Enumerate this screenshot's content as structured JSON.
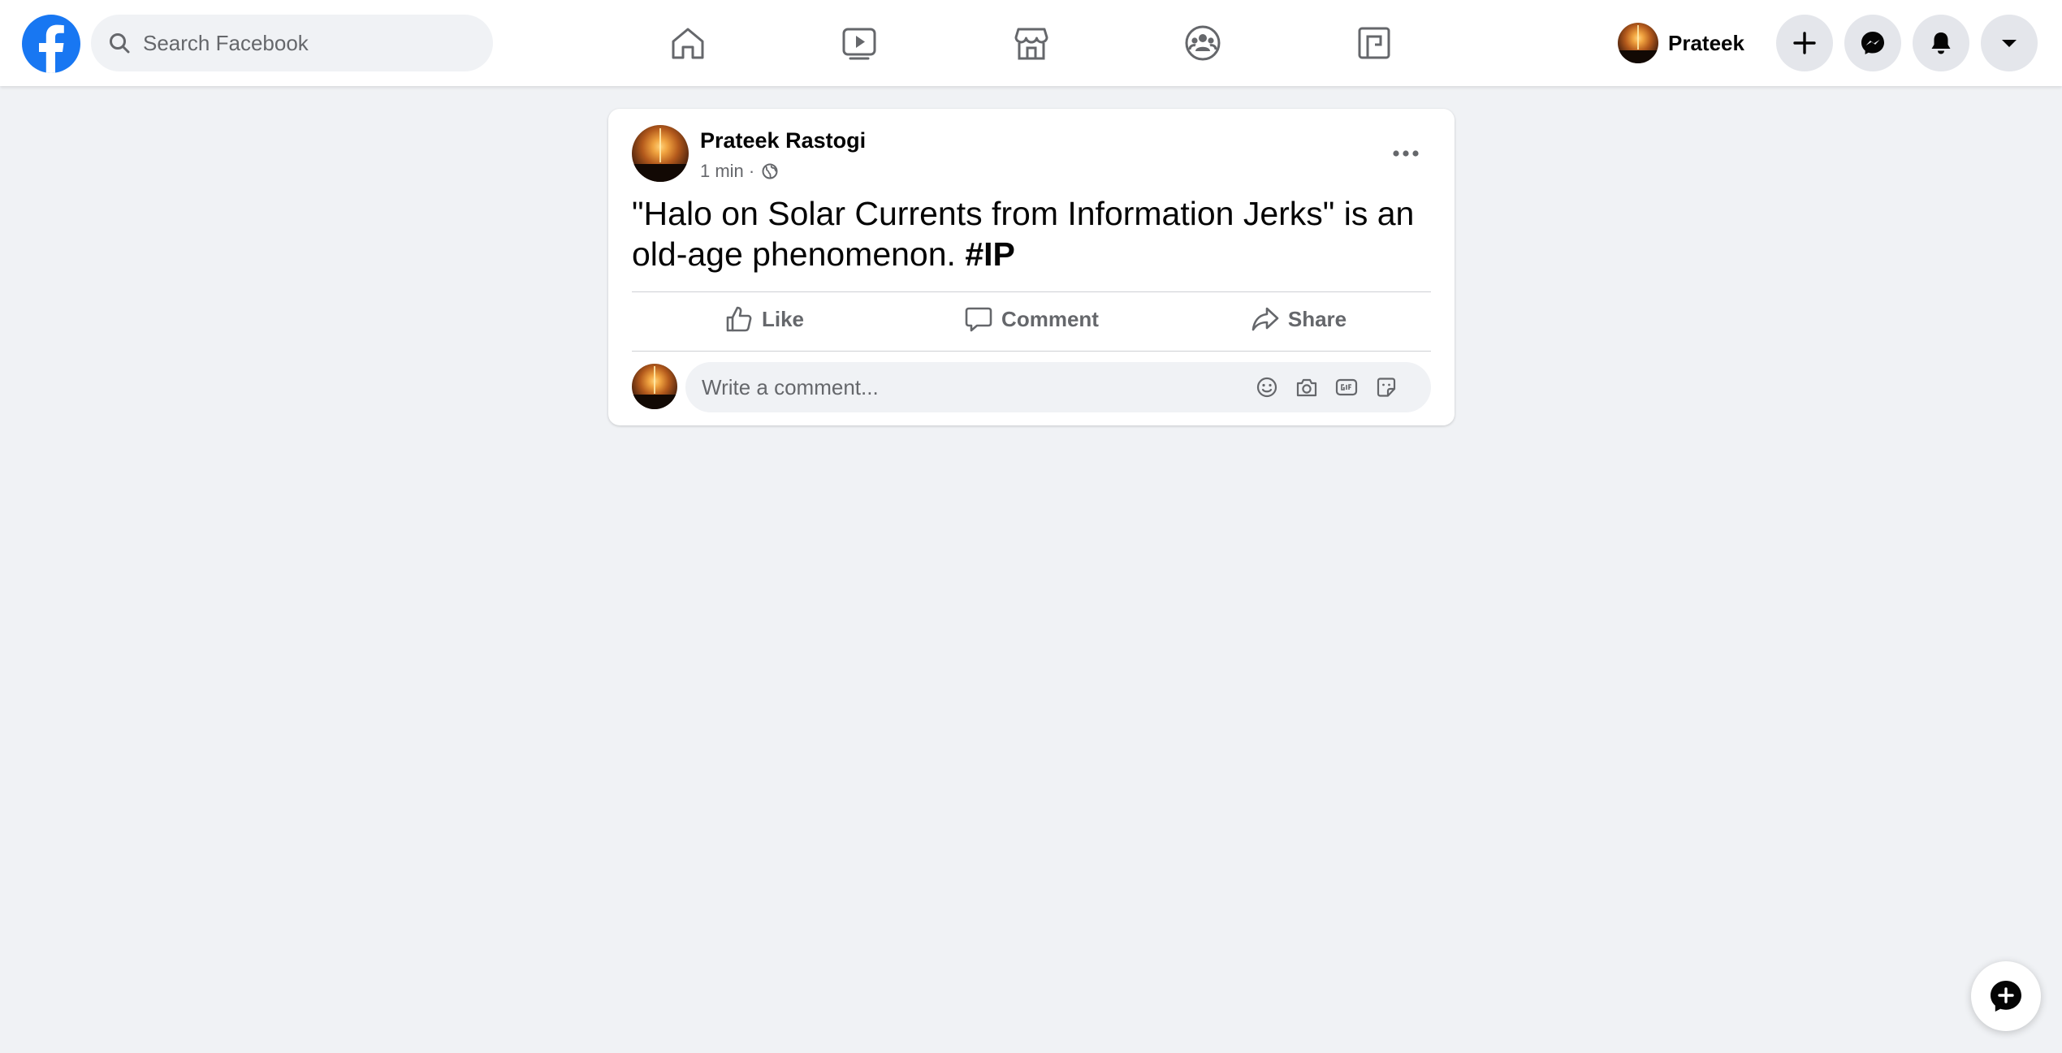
{
  "header": {
    "search_placeholder": "Search Facebook",
    "nav": [
      {
        "name": "home-icon"
      },
      {
        "name": "watch-icon"
      },
      {
        "name": "marketplace-icon"
      },
      {
        "name": "groups-icon"
      },
      {
        "name": "gaming-icon"
      }
    ],
    "profile_name": "Prateek",
    "actions": [
      "plus-icon",
      "messenger-icon",
      "notifications-icon",
      "account-menu-icon"
    ]
  },
  "post": {
    "author": "Prateek Rastogi",
    "time": "1 min ·",
    "audience_icon": "globe-icon",
    "text": "\"Halo on Solar Currents from Information Jerks\" is an old-age phenomenon.",
    "hashtag": "#IP",
    "actions": {
      "like": "Like",
      "comment": "Comment",
      "share": "Share"
    },
    "comment_placeholder": "Write a comment...",
    "comment_tools": [
      "emoji-icon",
      "camera-icon",
      "gif-icon",
      "sticker-icon"
    ]
  },
  "colors": {
    "brand": "#1877f2",
    "background": "#f0f2f5",
    "secondary_text": "#65676b"
  }
}
